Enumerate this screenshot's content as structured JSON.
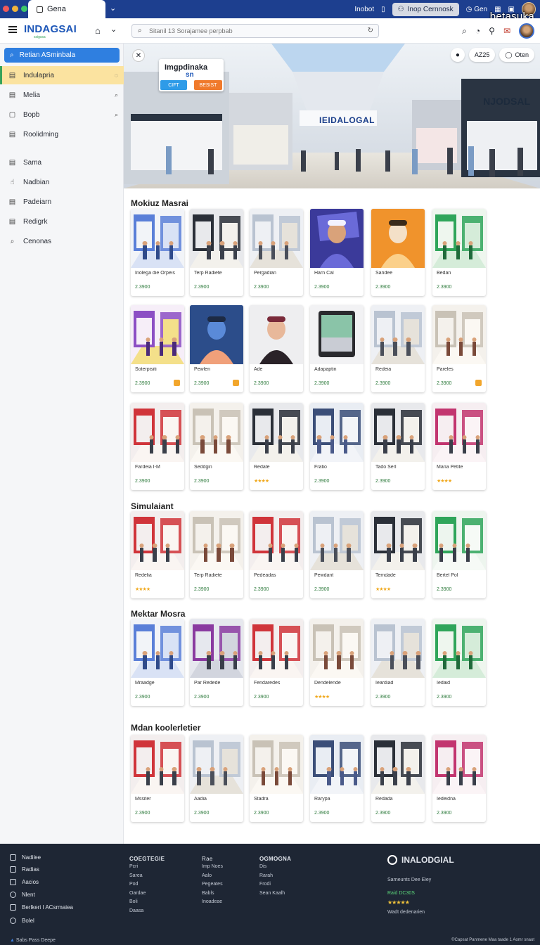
{
  "browser": {
    "tab_title": "Gena",
    "items": [
      "Inobot",
      "Inop Cernnosk",
      "Gen"
    ],
    "watermark": "betasuka"
  },
  "header": {
    "logo": "INDAGSAI",
    "logo_sub": "ssigssa",
    "search_placeholder": "Sitanil 13 Sorajamee perpbab"
  },
  "sidebar": {
    "search_label": "Retian ASminbala",
    "items": [
      {
        "label": "Indulapria",
        "icon": "▤",
        "active": true
      },
      {
        "label": "Melia",
        "icon": "▤"
      },
      {
        "label": "Bopb",
        "icon": "▢"
      },
      {
        "label": "Roolidming",
        "icon": "▤"
      },
      {
        "label": "Sama",
        "icon": "▤"
      },
      {
        "label": "Nadbian",
        "icon": "☝"
      },
      {
        "label": "Padeiarn",
        "icon": "▤"
      },
      {
        "label": "Redigrk",
        "icon": "▤"
      },
      {
        "label": "Cenonas",
        "icon": "⌕"
      }
    ]
  },
  "hero": {
    "card_title": "Imgpdinaka",
    "card_sub": "sn",
    "btn_left": "CIFT",
    "btn_right": "BESIST",
    "pill_count": "AZ25",
    "pill_open": "Oten",
    "sign_center": "IEIDALOGAL",
    "sign_right": "NJODSAL"
  },
  "sections": [
    {
      "title": "Mokiuz Masrai",
      "rows": [
        [
          {
            "caption": "Inolega die Orpeis",
            "price": "2.3900",
            "theme": "kiosk"
          },
          {
            "caption": "Terp Radiete",
            "price": "2.3900",
            "theme": "store-dark"
          },
          {
            "caption": "Pergadian",
            "price": "2.3900",
            "theme": "mall"
          },
          {
            "caption": "Harn Cal",
            "price": "2.3900",
            "theme": "poster-blue"
          },
          {
            "caption": "Sandee",
            "price": "2.3900",
            "theme": "poster-orange"
          },
          {
            "caption": "Bedan",
            "price": "2.3900",
            "theme": "kiosk-green"
          }
        ],
        [
          {
            "caption": "Soterpisiti",
            "price": "2.3900",
            "theme": "kiosk-purple",
            "badge": true
          },
          {
            "caption": "Pewlen",
            "price": "2.3900",
            "theme": "person-blue",
            "badge": true
          },
          {
            "caption": "Ade",
            "price": "2.3900",
            "theme": "person-woman"
          },
          {
            "caption": "Adapaptin",
            "price": "2.3900",
            "theme": "tablet"
          },
          {
            "caption": "Redeia",
            "price": "2.3900",
            "theme": "mall"
          },
          {
            "caption": "Pareles",
            "price": "2.3900",
            "theme": "store-light",
            "badge": true
          }
        ],
        [
          {
            "caption": "Fardeia I-M",
            "price": "2.3900",
            "theme": "store-red"
          },
          {
            "caption": "Seddgin",
            "price": "2.3900",
            "theme": "store-light"
          },
          {
            "caption": "Redate",
            "stars": "★★★★",
            "theme": "store-dark"
          },
          {
            "caption": "Fratio",
            "price": "2.3900",
            "theme": "store-blue"
          },
          {
            "caption": "Tado Serl",
            "price": "2.3900",
            "theme": "store-dark"
          },
          {
            "caption": "Mana Petite",
            "stars": "★★★★",
            "theme": "store-pink"
          }
        ]
      ]
    },
    {
      "title": "Simulaiant",
      "rows": [
        [
          {
            "caption": "Redelia",
            "stars": "★★★★",
            "theme": "store-red"
          },
          {
            "caption": "Terp Radiete",
            "price": "2.3900",
            "theme": "store-light"
          },
          {
            "caption": "Pedeadas",
            "price": "2.3900",
            "theme": "store-red"
          },
          {
            "caption": "Pewdant",
            "price": "2.3900",
            "theme": "mall"
          },
          {
            "caption": "Temdade",
            "stars": "★★★★",
            "theme": "store-dark"
          },
          {
            "caption": "Bertel Pol",
            "price": "2.3900",
            "theme": "store-green"
          }
        ]
      ]
    },
    {
      "title": "Mektar Mosra",
      "rows": [
        [
          {
            "caption": "Mraadge",
            "price": "2.3900",
            "theme": "kiosk"
          },
          {
            "caption": "Par Redede",
            "price": "2.3900",
            "theme": "street"
          },
          {
            "caption": "Fendaredes",
            "price": "2.3900",
            "theme": "store-red"
          },
          {
            "caption": "Dendelende",
            "stars": "★★★★",
            "theme": "store-light"
          },
          {
            "caption": "Ieardiad",
            "price": "2.3900",
            "theme": "mall"
          },
          {
            "caption": "Iedaid",
            "price": "2.3900",
            "theme": "kiosk-green"
          }
        ]
      ]
    },
    {
      "title": "Mdan koolerletier",
      "rows": [
        [
          {
            "caption": "Mssiter",
            "price": "2.3900",
            "theme": "store-red"
          },
          {
            "caption": "Aadia",
            "price": "2.3900",
            "theme": "mall"
          },
          {
            "caption": "Stadra",
            "price": "2.3900",
            "theme": "store-light"
          },
          {
            "caption": "Rarypa",
            "price": "2.3900",
            "theme": "store-blue"
          },
          {
            "caption": "Redada",
            "price": "2.3900",
            "theme": "store-dark"
          },
          {
            "caption": "Iedeidna",
            "price": "2.3900",
            "theme": "store-pink"
          }
        ]
      ]
    }
  ],
  "footer": {
    "left_items": [
      "Nadilee",
      "Radias",
      "Aacios",
      "Nlent",
      "Berlkeri I ACsrmaiea",
      "Bolel"
    ],
    "col1": {
      "head": "COEGTEGIE",
      "links": [
        "Pcri",
        "Sarea",
        "Pod",
        "Oardae",
        "Boli",
        "Daasa"
      ]
    },
    "col2": {
      "head": "Rae",
      "links": [
        "Imp Noes",
        "Aalo",
        "Pegeates",
        "Babls",
        "Inoadeae"
      ]
    },
    "col3": {
      "head": "OGMOGNA",
      "links": [
        "Dis",
        "Rarah",
        "Frodi",
        "Sean Kaalh"
      ]
    },
    "brand": "INALODGIAL",
    "brand_sub": "Sarneunts Dee Eiey",
    "brand_tag": "Raid DC30S",
    "rating": "★★★★★",
    "brand_small": "Wadt dedenarien",
    "bottom_left": "Sabs Pass Deepe",
    "copyright": "©Capsat Panmene Maa taade 1 Aomr snaot"
  },
  "colors": {
    "brand_blue": "#1e57b8",
    "accent_green": "#36a35a",
    "footer_bg": "#1e2634",
    "active_item": "#fbe3a0"
  }
}
